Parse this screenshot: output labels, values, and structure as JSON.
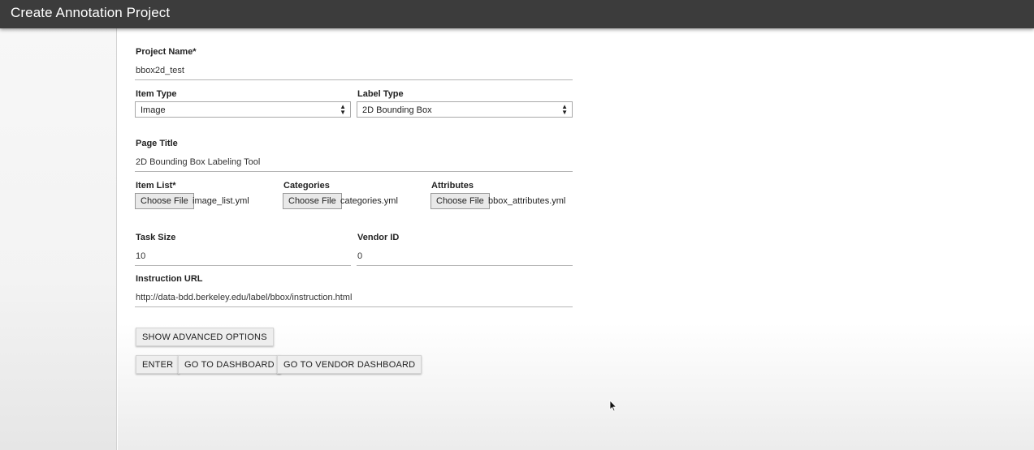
{
  "appbar": {
    "title": "Create Annotation Project"
  },
  "form": {
    "project_name": {
      "label": "Project Name*",
      "value": "bbox2d_test"
    },
    "item_type": {
      "label": "Item Type",
      "value": "Image"
    },
    "label_type": {
      "label": "Label Type",
      "value": "2D Bounding Box"
    },
    "page_title": {
      "label": "Page Title",
      "value": "2D Bounding Box Labeling Tool"
    },
    "item_list": {
      "label": "Item List*",
      "button": "Choose File",
      "file": "image_list.yml"
    },
    "categories": {
      "label": "Categories",
      "button": "Choose File",
      "file": "categories.yml"
    },
    "attributes": {
      "label": "Attributes",
      "button": "Choose File",
      "file": "bbox_attributes.yml"
    },
    "task_size": {
      "label": "Task Size",
      "value": "10"
    },
    "vendor_id": {
      "label": "Vendor ID",
      "value": "0"
    },
    "instruction_url": {
      "label": "Instruction URL",
      "value": "http://data-bdd.berkeley.edu/label/bbox/instruction.html"
    }
  },
  "buttons": {
    "advanced": "SHOW ADVANCED OPTIONS",
    "enter": "ENTER",
    "dashboard": "GO TO DASHBOARD",
    "vendor_dashboard": "GO TO VENDOR DASHBOARD"
  },
  "icons": {
    "select_arrow": "up-down-arrow-icon",
    "cursor": "mouse-pointer-icon"
  },
  "colors": {
    "appbar": "#3c3c3c",
    "appbar_text": "#ffffff",
    "button_bg": "#eeeeee"
  }
}
